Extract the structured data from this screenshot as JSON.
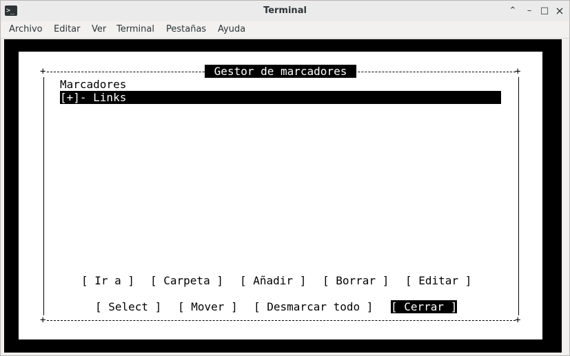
{
  "window": {
    "title": "Terminal",
    "app_icon_glyph": ">_",
    "controls": {
      "min": "⌃",
      "restore": "–",
      "max": "□",
      "close": "×"
    }
  },
  "menu": {
    "items": [
      "Archivo",
      "Editar",
      "Ver",
      "Terminal",
      "Pestañas",
      "Ayuda"
    ]
  },
  "dialog": {
    "title": "Gestor de marcadores",
    "tree": {
      "root": "Marcadores",
      "items": [
        {
          "label": "[+]- Links",
          "selected": true
        }
      ]
    },
    "buttons_row1": [
      "[ Ir a ]",
      "[ Carpeta ]",
      "[ Añadir ]",
      "[ Borrar ]",
      "[ Editar ]"
    ],
    "buttons_row2": [
      "[ Select ]",
      "[ Mover ]",
      "[ Desmarcar todo ]",
      "[ Cerrar ]"
    ],
    "focused_button": "[ Cerrar ]"
  },
  "colors": {
    "terminal_bg": "#000000",
    "dialog_bg": "#ffffff",
    "selection_bg": "#000000",
    "selection_fg": "#ffffff"
  }
}
